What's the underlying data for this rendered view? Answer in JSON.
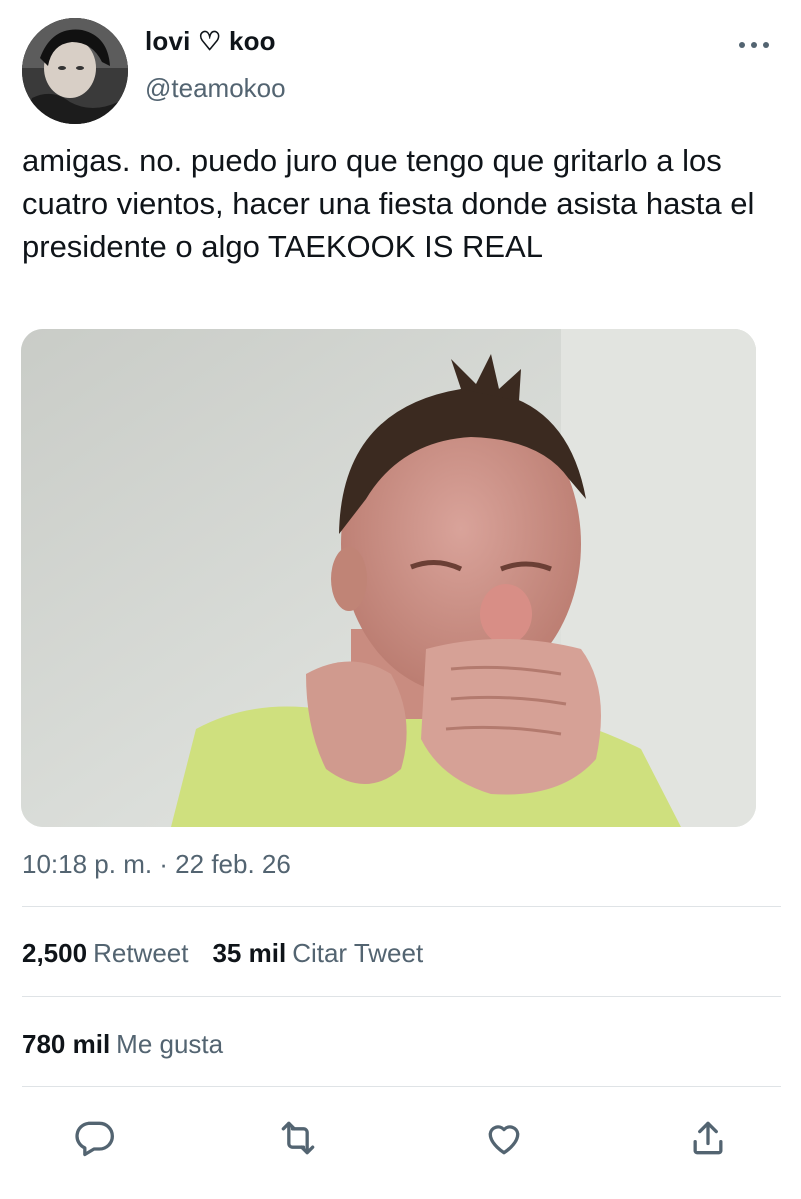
{
  "user": {
    "display_name": "lovi ♡ koo",
    "handle": "@teamokoo"
  },
  "tweet": {
    "text": "amigas. no. puedo juro que tengo que gritarlo a los cuatro vientos, hacer una fiesta donde asista hasta el presidente o algo TAEKOOK IS REAL",
    "timestamp": "10:18 p. m. · 22 feb. 26"
  },
  "stats": {
    "retweets_count": "2,500",
    "retweets_label": "Retweet",
    "quotes_count": "35 mil",
    "quotes_label": "Citar Tweet",
    "likes_count": "780 mil",
    "likes_label": "Me gusta"
  },
  "icons": {
    "more": "more-dots-icon",
    "reply": "reply-bubble-icon",
    "retweet": "retweet-arrows-icon",
    "like": "heart-icon",
    "share": "share-upload-icon"
  },
  "colors": {
    "text": "#0f1419",
    "secondary": "#536471",
    "divider": "#dfe3e6"
  }
}
